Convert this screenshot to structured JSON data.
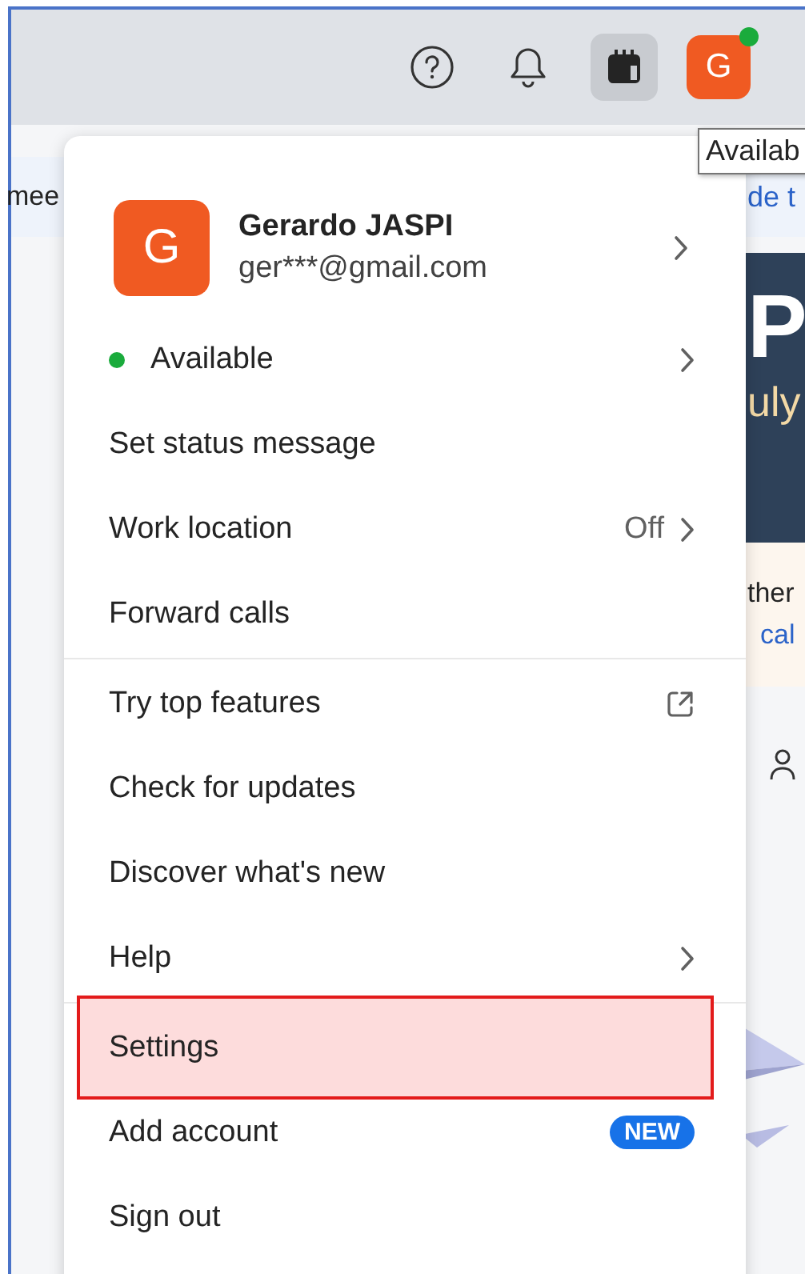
{
  "toolbar": {
    "buttons": [
      {
        "kind": "help",
        "selected": false
      },
      {
        "kind": "bell",
        "selected": false
      },
      {
        "kind": "calendar",
        "selected": true
      }
    ],
    "avatar": {
      "initial": "G",
      "online": true
    }
  },
  "tooltip": "Availab",
  "background": {
    "left_text": "mee",
    "right_link": "de t",
    "banner_title": "P",
    "banner_subtitle": "uly",
    "notice_text": "ther",
    "notice_link": "cal"
  },
  "menu": {
    "profile": {
      "initial": "G",
      "name": "Gerardo JASPI",
      "email": "ger***@gmail.com"
    },
    "sections": [
      [
        {
          "kind": "status",
          "label": "Available",
          "color": "#1aab3c",
          "highlighted": false
        },
        {
          "kind": "plain",
          "label": "Set status message",
          "highlighted": false
        },
        {
          "kind": "value",
          "label": "Work location",
          "value": "Off",
          "highlighted": false
        },
        {
          "kind": "plain",
          "label": "Forward calls",
          "highlighted": false
        }
      ],
      [
        {
          "kind": "external",
          "label": "Try top features",
          "highlighted": false
        },
        {
          "kind": "plain",
          "label": "Check for updates",
          "highlighted": false
        },
        {
          "kind": "plain",
          "label": "Discover what's new",
          "highlighted": false
        },
        {
          "kind": "submenu",
          "label": "Help",
          "highlighted": false
        }
      ],
      [
        {
          "kind": "plain",
          "label": "Settings",
          "highlighted": true
        },
        {
          "kind": "badge",
          "label": "Add account",
          "badge": "NEW",
          "highlighted": false
        },
        {
          "kind": "plain",
          "label": "Sign out",
          "highlighted": false
        }
      ]
    ]
  }
}
